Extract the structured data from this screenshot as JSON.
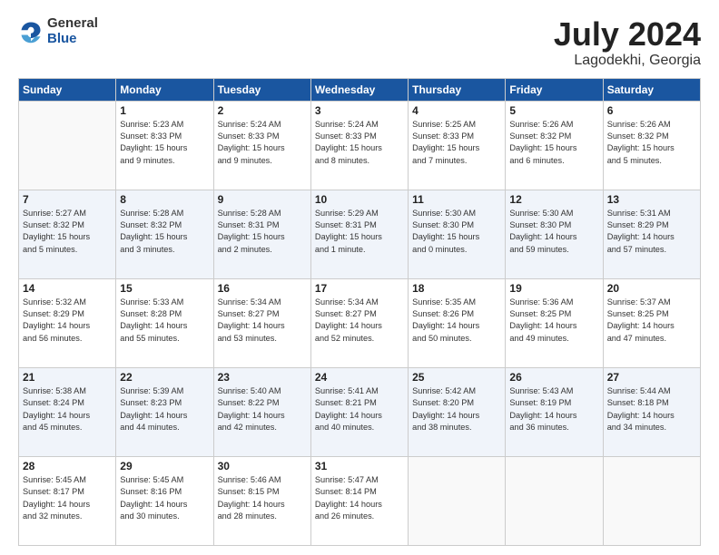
{
  "header": {
    "logo_general": "General",
    "logo_blue": "Blue",
    "month_title": "July 2024",
    "location": "Lagodekhi, Georgia"
  },
  "days_of_week": [
    "Sunday",
    "Monday",
    "Tuesday",
    "Wednesday",
    "Thursday",
    "Friday",
    "Saturday"
  ],
  "weeks": [
    [
      {
        "day": "",
        "info": ""
      },
      {
        "day": "1",
        "info": "Sunrise: 5:23 AM\nSunset: 8:33 PM\nDaylight: 15 hours\nand 9 minutes."
      },
      {
        "day": "2",
        "info": "Sunrise: 5:24 AM\nSunset: 8:33 PM\nDaylight: 15 hours\nand 9 minutes."
      },
      {
        "day": "3",
        "info": "Sunrise: 5:24 AM\nSunset: 8:33 PM\nDaylight: 15 hours\nand 8 minutes."
      },
      {
        "day": "4",
        "info": "Sunrise: 5:25 AM\nSunset: 8:33 PM\nDaylight: 15 hours\nand 7 minutes."
      },
      {
        "day": "5",
        "info": "Sunrise: 5:26 AM\nSunset: 8:32 PM\nDaylight: 15 hours\nand 6 minutes."
      },
      {
        "day": "6",
        "info": "Sunrise: 5:26 AM\nSunset: 8:32 PM\nDaylight: 15 hours\nand 5 minutes."
      }
    ],
    [
      {
        "day": "7",
        "info": "Sunrise: 5:27 AM\nSunset: 8:32 PM\nDaylight: 15 hours\nand 5 minutes."
      },
      {
        "day": "8",
        "info": "Sunrise: 5:28 AM\nSunset: 8:32 PM\nDaylight: 15 hours\nand 3 minutes."
      },
      {
        "day": "9",
        "info": "Sunrise: 5:28 AM\nSunset: 8:31 PM\nDaylight: 15 hours\nand 2 minutes."
      },
      {
        "day": "10",
        "info": "Sunrise: 5:29 AM\nSunset: 8:31 PM\nDaylight: 15 hours\nand 1 minute."
      },
      {
        "day": "11",
        "info": "Sunrise: 5:30 AM\nSunset: 8:30 PM\nDaylight: 15 hours\nand 0 minutes."
      },
      {
        "day": "12",
        "info": "Sunrise: 5:30 AM\nSunset: 8:30 PM\nDaylight: 14 hours\nand 59 minutes."
      },
      {
        "day": "13",
        "info": "Sunrise: 5:31 AM\nSunset: 8:29 PM\nDaylight: 14 hours\nand 57 minutes."
      }
    ],
    [
      {
        "day": "14",
        "info": "Sunrise: 5:32 AM\nSunset: 8:29 PM\nDaylight: 14 hours\nand 56 minutes."
      },
      {
        "day": "15",
        "info": "Sunrise: 5:33 AM\nSunset: 8:28 PM\nDaylight: 14 hours\nand 55 minutes."
      },
      {
        "day": "16",
        "info": "Sunrise: 5:34 AM\nSunset: 8:27 PM\nDaylight: 14 hours\nand 53 minutes."
      },
      {
        "day": "17",
        "info": "Sunrise: 5:34 AM\nSunset: 8:27 PM\nDaylight: 14 hours\nand 52 minutes."
      },
      {
        "day": "18",
        "info": "Sunrise: 5:35 AM\nSunset: 8:26 PM\nDaylight: 14 hours\nand 50 minutes."
      },
      {
        "day": "19",
        "info": "Sunrise: 5:36 AM\nSunset: 8:25 PM\nDaylight: 14 hours\nand 49 minutes."
      },
      {
        "day": "20",
        "info": "Sunrise: 5:37 AM\nSunset: 8:25 PM\nDaylight: 14 hours\nand 47 minutes."
      }
    ],
    [
      {
        "day": "21",
        "info": "Sunrise: 5:38 AM\nSunset: 8:24 PM\nDaylight: 14 hours\nand 45 minutes."
      },
      {
        "day": "22",
        "info": "Sunrise: 5:39 AM\nSunset: 8:23 PM\nDaylight: 14 hours\nand 44 minutes."
      },
      {
        "day": "23",
        "info": "Sunrise: 5:40 AM\nSunset: 8:22 PM\nDaylight: 14 hours\nand 42 minutes."
      },
      {
        "day": "24",
        "info": "Sunrise: 5:41 AM\nSunset: 8:21 PM\nDaylight: 14 hours\nand 40 minutes."
      },
      {
        "day": "25",
        "info": "Sunrise: 5:42 AM\nSunset: 8:20 PM\nDaylight: 14 hours\nand 38 minutes."
      },
      {
        "day": "26",
        "info": "Sunrise: 5:43 AM\nSunset: 8:19 PM\nDaylight: 14 hours\nand 36 minutes."
      },
      {
        "day": "27",
        "info": "Sunrise: 5:44 AM\nSunset: 8:18 PM\nDaylight: 14 hours\nand 34 minutes."
      }
    ],
    [
      {
        "day": "28",
        "info": "Sunrise: 5:45 AM\nSunset: 8:17 PM\nDaylight: 14 hours\nand 32 minutes."
      },
      {
        "day": "29",
        "info": "Sunrise: 5:45 AM\nSunset: 8:16 PM\nDaylight: 14 hours\nand 30 minutes."
      },
      {
        "day": "30",
        "info": "Sunrise: 5:46 AM\nSunset: 8:15 PM\nDaylight: 14 hours\nand 28 minutes."
      },
      {
        "day": "31",
        "info": "Sunrise: 5:47 AM\nSunset: 8:14 PM\nDaylight: 14 hours\nand 26 minutes."
      },
      {
        "day": "",
        "info": ""
      },
      {
        "day": "",
        "info": ""
      },
      {
        "day": "",
        "info": ""
      }
    ]
  ]
}
